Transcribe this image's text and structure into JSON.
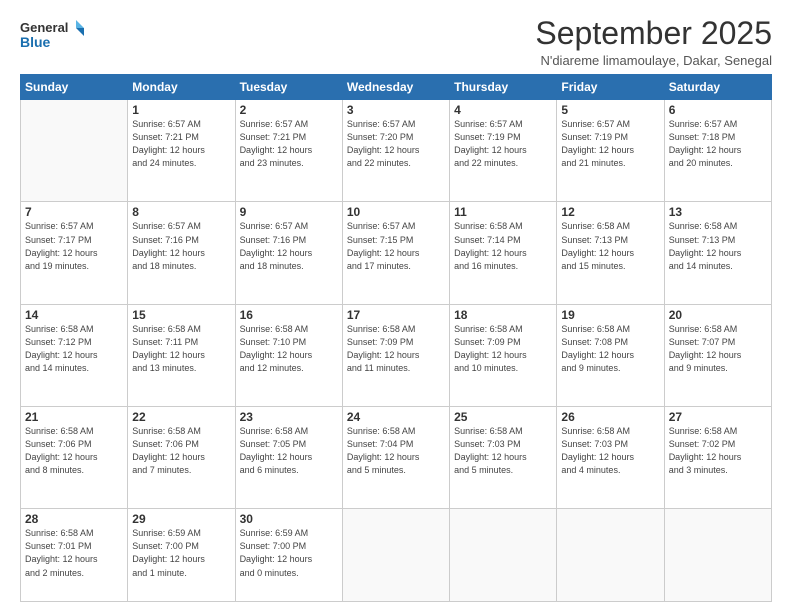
{
  "logo": {
    "line1": "General",
    "line2": "Blue"
  },
  "header": {
    "title": "September 2025",
    "subtitle": "N'diareme limamoulaye, Dakar, Senegal"
  },
  "weekdays": [
    "Sunday",
    "Monday",
    "Tuesday",
    "Wednesday",
    "Thursday",
    "Friday",
    "Saturday"
  ],
  "weeks": [
    [
      {
        "day": "",
        "info": ""
      },
      {
        "day": "1",
        "info": "Sunrise: 6:57 AM\nSunset: 7:21 PM\nDaylight: 12 hours\nand 24 minutes."
      },
      {
        "day": "2",
        "info": "Sunrise: 6:57 AM\nSunset: 7:21 PM\nDaylight: 12 hours\nand 23 minutes."
      },
      {
        "day": "3",
        "info": "Sunrise: 6:57 AM\nSunset: 7:20 PM\nDaylight: 12 hours\nand 22 minutes."
      },
      {
        "day": "4",
        "info": "Sunrise: 6:57 AM\nSunset: 7:19 PM\nDaylight: 12 hours\nand 22 minutes."
      },
      {
        "day": "5",
        "info": "Sunrise: 6:57 AM\nSunset: 7:19 PM\nDaylight: 12 hours\nand 21 minutes."
      },
      {
        "day": "6",
        "info": "Sunrise: 6:57 AM\nSunset: 7:18 PM\nDaylight: 12 hours\nand 20 minutes."
      }
    ],
    [
      {
        "day": "7",
        "info": "Sunrise: 6:57 AM\nSunset: 7:17 PM\nDaylight: 12 hours\nand 19 minutes."
      },
      {
        "day": "8",
        "info": "Sunrise: 6:57 AM\nSunset: 7:16 PM\nDaylight: 12 hours\nand 18 minutes."
      },
      {
        "day": "9",
        "info": "Sunrise: 6:57 AM\nSunset: 7:16 PM\nDaylight: 12 hours\nand 18 minutes."
      },
      {
        "day": "10",
        "info": "Sunrise: 6:57 AM\nSunset: 7:15 PM\nDaylight: 12 hours\nand 17 minutes."
      },
      {
        "day": "11",
        "info": "Sunrise: 6:58 AM\nSunset: 7:14 PM\nDaylight: 12 hours\nand 16 minutes."
      },
      {
        "day": "12",
        "info": "Sunrise: 6:58 AM\nSunset: 7:13 PM\nDaylight: 12 hours\nand 15 minutes."
      },
      {
        "day": "13",
        "info": "Sunrise: 6:58 AM\nSunset: 7:13 PM\nDaylight: 12 hours\nand 14 minutes."
      }
    ],
    [
      {
        "day": "14",
        "info": "Sunrise: 6:58 AM\nSunset: 7:12 PM\nDaylight: 12 hours\nand 14 minutes."
      },
      {
        "day": "15",
        "info": "Sunrise: 6:58 AM\nSunset: 7:11 PM\nDaylight: 12 hours\nand 13 minutes."
      },
      {
        "day": "16",
        "info": "Sunrise: 6:58 AM\nSunset: 7:10 PM\nDaylight: 12 hours\nand 12 minutes."
      },
      {
        "day": "17",
        "info": "Sunrise: 6:58 AM\nSunset: 7:09 PM\nDaylight: 12 hours\nand 11 minutes."
      },
      {
        "day": "18",
        "info": "Sunrise: 6:58 AM\nSunset: 7:09 PM\nDaylight: 12 hours\nand 10 minutes."
      },
      {
        "day": "19",
        "info": "Sunrise: 6:58 AM\nSunset: 7:08 PM\nDaylight: 12 hours\nand 9 minutes."
      },
      {
        "day": "20",
        "info": "Sunrise: 6:58 AM\nSunset: 7:07 PM\nDaylight: 12 hours\nand 9 minutes."
      }
    ],
    [
      {
        "day": "21",
        "info": "Sunrise: 6:58 AM\nSunset: 7:06 PM\nDaylight: 12 hours\nand 8 minutes."
      },
      {
        "day": "22",
        "info": "Sunrise: 6:58 AM\nSunset: 7:06 PM\nDaylight: 12 hours\nand 7 minutes."
      },
      {
        "day": "23",
        "info": "Sunrise: 6:58 AM\nSunset: 7:05 PM\nDaylight: 12 hours\nand 6 minutes."
      },
      {
        "day": "24",
        "info": "Sunrise: 6:58 AM\nSunset: 7:04 PM\nDaylight: 12 hours\nand 5 minutes."
      },
      {
        "day": "25",
        "info": "Sunrise: 6:58 AM\nSunset: 7:03 PM\nDaylight: 12 hours\nand 5 minutes."
      },
      {
        "day": "26",
        "info": "Sunrise: 6:58 AM\nSunset: 7:03 PM\nDaylight: 12 hours\nand 4 minutes."
      },
      {
        "day": "27",
        "info": "Sunrise: 6:58 AM\nSunset: 7:02 PM\nDaylight: 12 hours\nand 3 minutes."
      }
    ],
    [
      {
        "day": "28",
        "info": "Sunrise: 6:58 AM\nSunset: 7:01 PM\nDaylight: 12 hours\nand 2 minutes."
      },
      {
        "day": "29",
        "info": "Sunrise: 6:59 AM\nSunset: 7:00 PM\nDaylight: 12 hours\nand 1 minute."
      },
      {
        "day": "30",
        "info": "Sunrise: 6:59 AM\nSunset: 7:00 PM\nDaylight: 12 hours\nand 0 minutes."
      },
      {
        "day": "",
        "info": ""
      },
      {
        "day": "",
        "info": ""
      },
      {
        "day": "",
        "info": ""
      },
      {
        "day": "",
        "info": ""
      }
    ]
  ]
}
